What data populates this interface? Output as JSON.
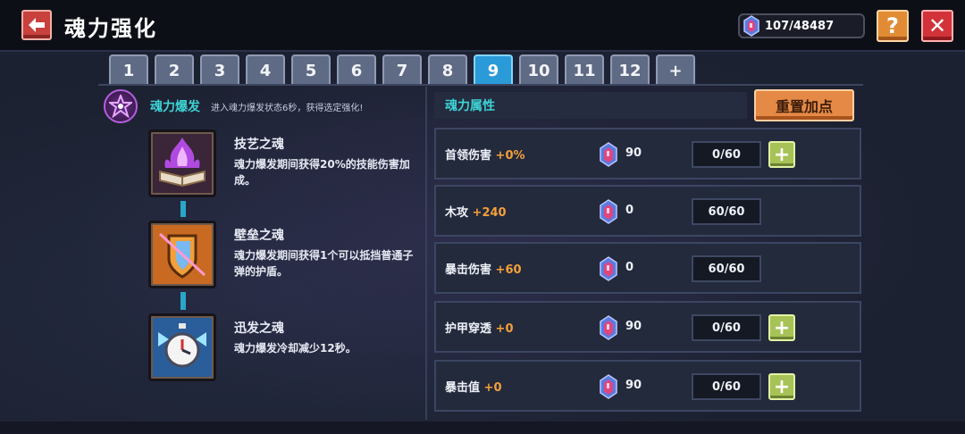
{
  "header": {
    "title": "魂力强化",
    "currency": "107/48487",
    "help_label": "?",
    "close_label": "✕"
  },
  "tabs": [
    "1",
    "2",
    "3",
    "4",
    "5",
    "6",
    "7",
    "8",
    "9",
    "10",
    "11",
    "12",
    "+"
  ],
  "active_tab": "9",
  "burst": {
    "name": "魂力爆发",
    "description": "进入魂力爆发状态6秒，获得选定强化!"
  },
  "skills": [
    {
      "name": "技艺之魂",
      "description": "魂力爆发期间获得20%的技能伤害加成。",
      "icon": "purple-flame-book-icon"
    },
    {
      "name": "壁垒之魂",
      "description": "魂力爆发期间获得1个可以抵挡普通子弹的护盾。",
      "icon": "shield-icon"
    },
    {
      "name": "迅发之魂",
      "description": "魂力爆发冷却减少12秒。",
      "icon": "stopwatch-icon"
    }
  ],
  "attributes_panel": {
    "title": "魂力属性",
    "reset_label": "重置加点",
    "rows": [
      {
        "label": "首领伤害",
        "bonus": "+0%",
        "cost": "90",
        "count": "0/60",
        "can_add": true
      },
      {
        "label": "木攻",
        "bonus": "+240",
        "cost": "0",
        "count": "60/60",
        "can_add": false
      },
      {
        "label": "暴击伤害",
        "bonus": "+60",
        "cost": "0",
        "count": "60/60",
        "can_add": false
      },
      {
        "label": "护甲穿透",
        "bonus": "+0",
        "cost": "90",
        "count": "0/60",
        "can_add": true
      },
      {
        "label": "暴击值",
        "bonus": "+0",
        "cost": "90",
        "count": "0/60",
        "can_add": true
      }
    ]
  },
  "colors": {
    "accent_cyan": "#3ed3d5",
    "bonus_orange": "#f3a03a",
    "active_tab": "#2a9ad8"
  }
}
